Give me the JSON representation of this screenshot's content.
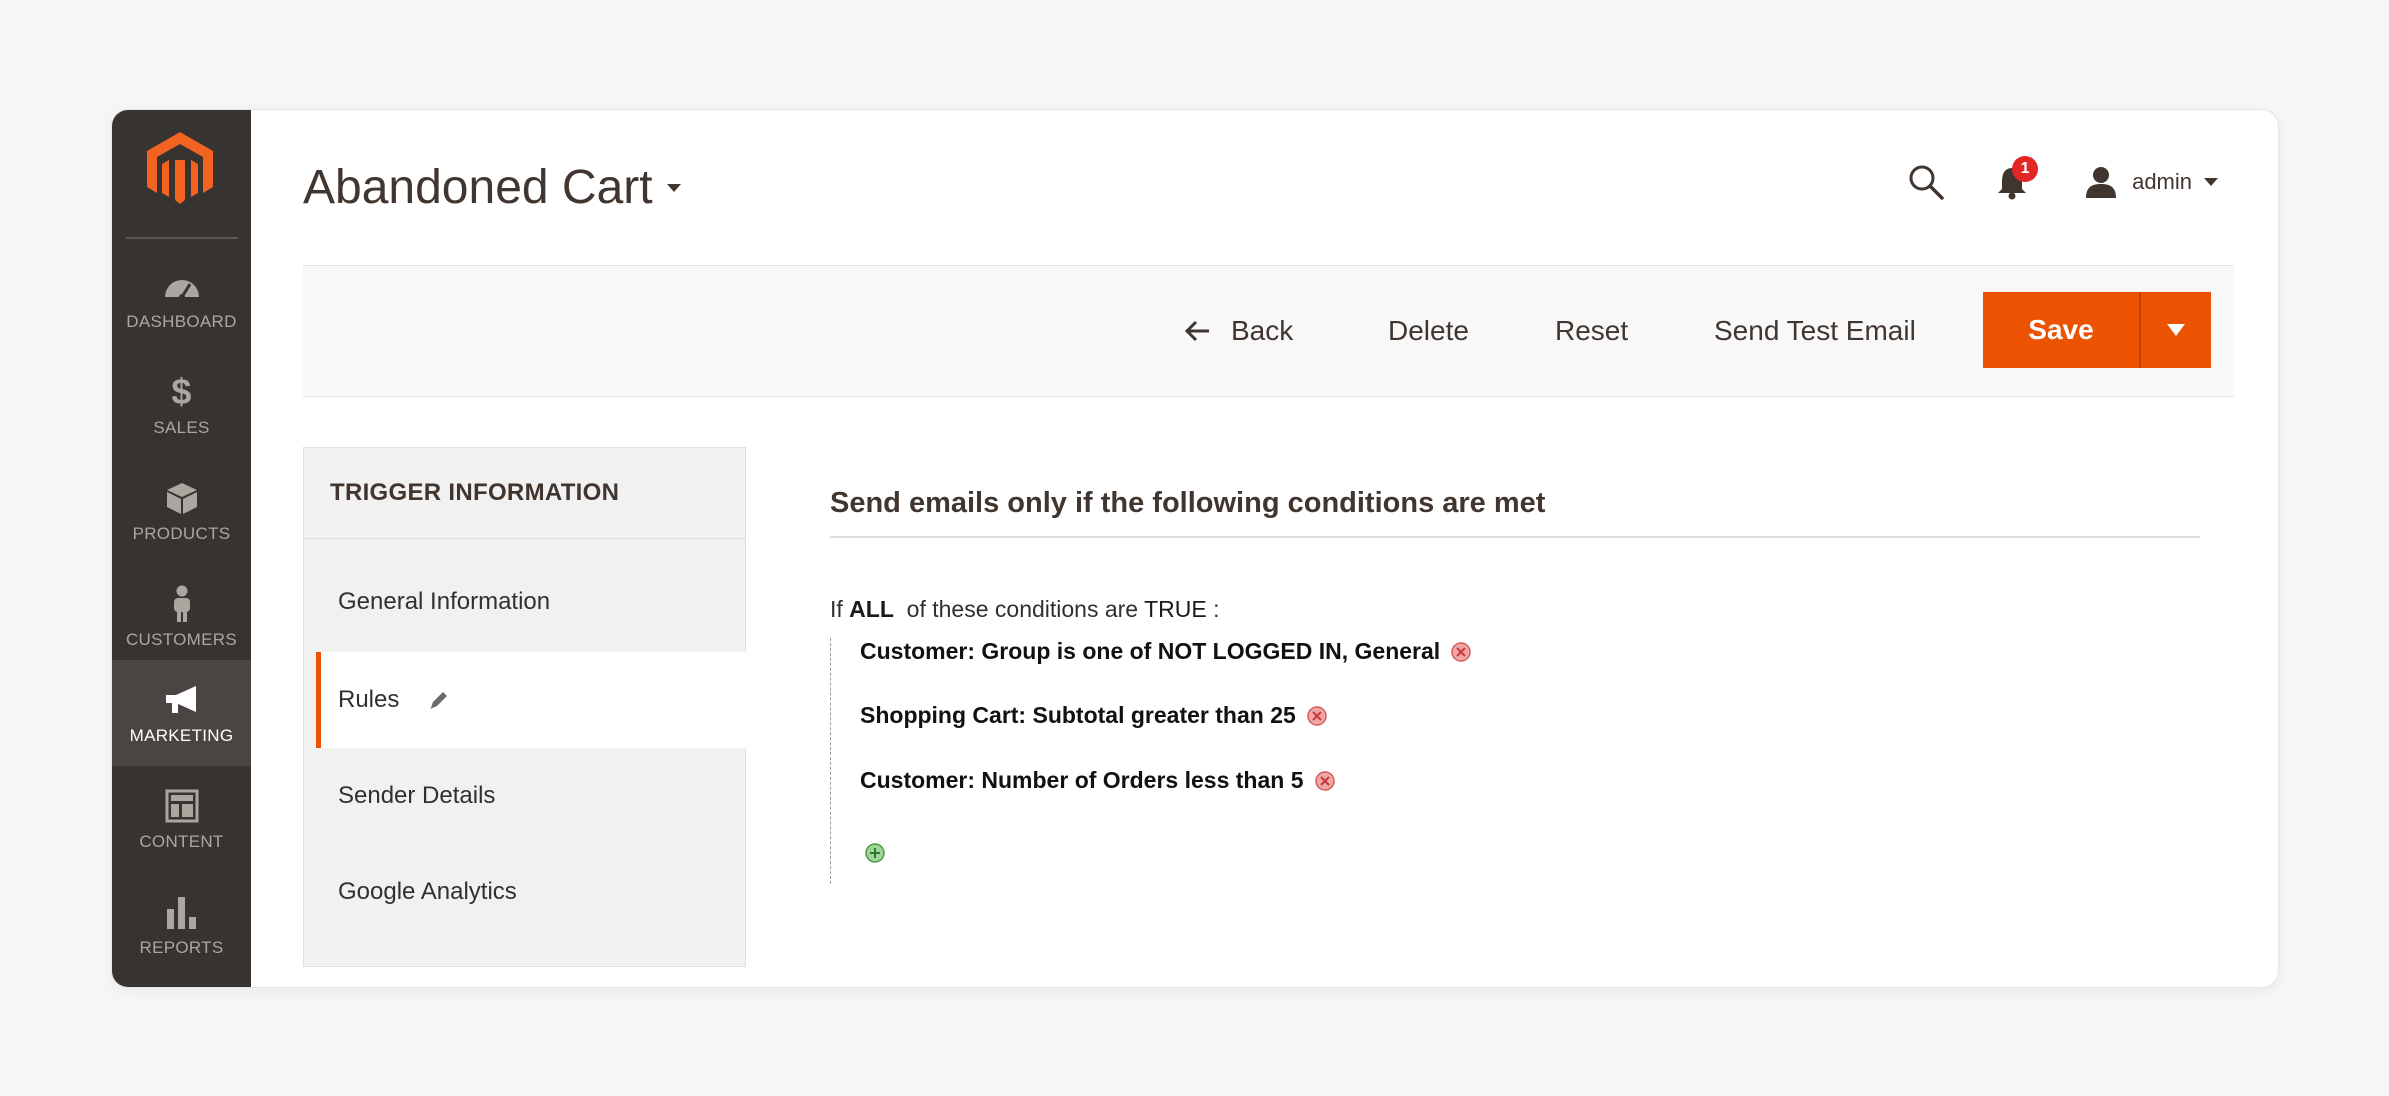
{
  "sidebar": {
    "items": [
      {
        "label": "DASHBOARD",
        "icon": "dashboard-icon"
      },
      {
        "label": "SALES",
        "icon": "dollar-icon"
      },
      {
        "label": "PRODUCTS",
        "icon": "box-icon"
      },
      {
        "label": "CUSTOMERS",
        "icon": "person-icon"
      },
      {
        "label": "MARKETING",
        "icon": "megaphone-icon",
        "active": true
      },
      {
        "label": "CONTENT",
        "icon": "layout-icon"
      },
      {
        "label": "REPORTS",
        "icon": "bar-chart-icon"
      }
    ]
  },
  "header": {
    "title": "Abandoned Cart",
    "notification_count": "1",
    "user": "admin"
  },
  "toolbar": {
    "back": "Back",
    "delete": "Delete",
    "reset": "Reset",
    "send_test": "Send Test Email",
    "save": "Save"
  },
  "tabs": {
    "title": "TRIGGER INFORMATION",
    "items": [
      "General Information",
      "Rules",
      "Sender Details",
      "Google Analytics"
    ]
  },
  "rules": {
    "section_title": "Send emails only if the following conditions are met",
    "prefix": "If",
    "aggregator": "ALL",
    "middle": "of these conditions are",
    "value": "TRUE",
    "suffix": ":",
    "conditions": [
      {
        "attribute": "Customer: Group",
        "operator": "is one of",
        "value": "NOT LOGGED IN, General"
      },
      {
        "attribute": "Shopping Cart: Subtotal",
        "operator": "greater than",
        "value": "25"
      },
      {
        "attribute": "Customer: Number of Orders",
        "operator": "less than",
        "value": "5"
      }
    ]
  },
  "colors": {
    "accent": "#eb5202",
    "sidebar_bg": "#373330",
    "badge": "#e22626"
  }
}
